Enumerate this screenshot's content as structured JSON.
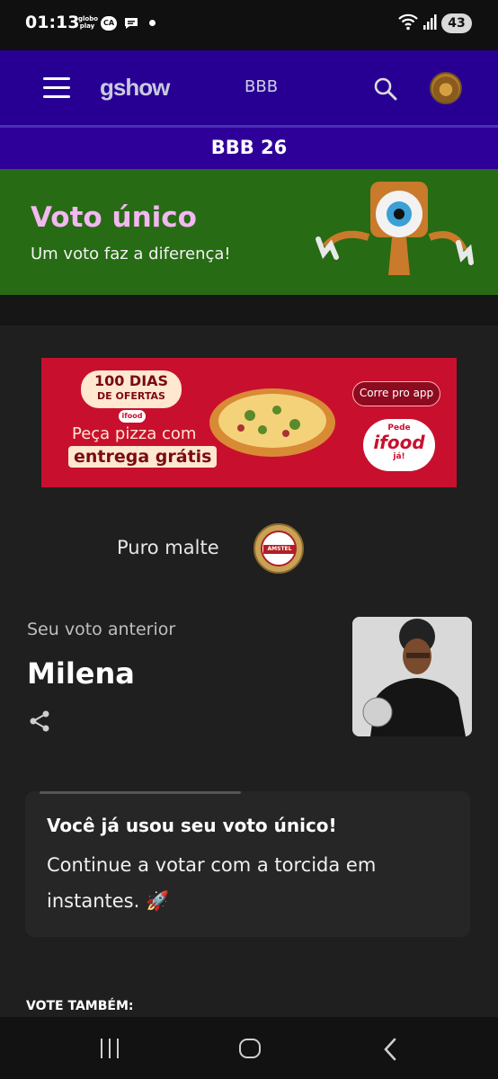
{
  "status_bar": {
    "time": "01:13",
    "globoplay": "globo play",
    "ca_badge": "CA",
    "battery": "43",
    "icons": [
      "globoplay-icon",
      "ca-icon",
      "chat-icon",
      "dot-icon",
      "wifi-icon",
      "signal-icon",
      "battery-icon"
    ]
  },
  "header": {
    "logo": "gshow",
    "nav_label": "BBB",
    "icons": [
      "menu-icon",
      "search-icon",
      "avatar"
    ]
  },
  "bbb_bar": {
    "title": "BBB 26"
  },
  "voto_banner": {
    "title": "Voto único",
    "subtitle": "Um voto faz a diferença!"
  },
  "ad": {
    "badge_line1": "100 DIAS",
    "badge_line2": "DE OFERTAS",
    "brand_small": "ifood",
    "headline1": "Peça pizza com",
    "headline2": "entrega grátis",
    "cta": "Corre pro app",
    "pede": "Pede",
    "ifood": "ifood",
    "ja": "já!"
  },
  "sponsor": {
    "text": "Puro malte",
    "logo_word": "AMSTEL"
  },
  "previous_vote": {
    "label": "Seu voto anterior",
    "name": "Milena"
  },
  "info_card": {
    "bold": "Você já usou seu voto único!",
    "text": "Continue a votar com a torcida em instantes. 🚀"
  },
  "vote_tambem": "VOTE TAMBÉM:",
  "colors": {
    "header_bg": "#270093",
    "bbb_bar_bg": "#2e0099",
    "banner_green": "#276b14",
    "banner_title_pink": "#f3b8f1",
    "page_bg": "#1f1f1f",
    "ad_red": "#c8102e"
  }
}
